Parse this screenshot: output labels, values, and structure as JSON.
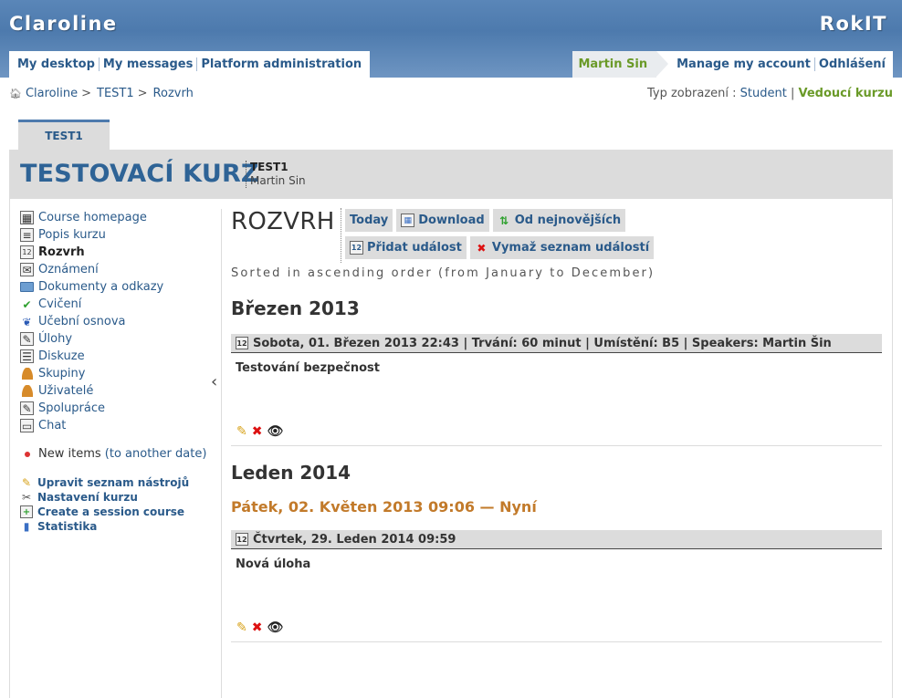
{
  "header": {
    "brand_left": "Claroline",
    "brand_right": "RokIT",
    "nav_left": [
      "My desktop",
      "My messages",
      "Platform administration"
    ],
    "user_name": "Martin Sin",
    "nav_right": [
      "Manage my account",
      "Odhlášení"
    ]
  },
  "breadcrumb": {
    "items": [
      "Claroline",
      "TEST1",
      "Rozvrh"
    ],
    "separator": ">"
  },
  "view_mode": {
    "label": "Typ zobrazení :",
    "student": "Student",
    "separator": "|",
    "manager": "Vedoucí kurzu"
  },
  "course": {
    "tab": "TEST1",
    "title": "TESTOVACÍ KURZ",
    "code": "TEST1",
    "teacher": "Martin Sin"
  },
  "sidebar": {
    "items": [
      {
        "label": "Course homepage",
        "icon": "course-homepage-icon"
      },
      {
        "label": "Popis kurzu",
        "icon": "description-icon"
      },
      {
        "label": "Rozvrh",
        "icon": "calendar-icon"
      },
      {
        "label": "Oznámení",
        "icon": "announcement-icon"
      },
      {
        "label": "Dokumenty a odkazy",
        "icon": "folder-icon"
      },
      {
        "label": "Cvičení",
        "icon": "checkmark-icon"
      },
      {
        "label": "Učební osnova",
        "icon": "learning-path-icon"
      },
      {
        "label": "Úlohy",
        "icon": "assignment-icon"
      },
      {
        "label": "Diskuze",
        "icon": "forum-icon"
      },
      {
        "label": "Skupiny",
        "icon": "groups-icon"
      },
      {
        "label": "Uživatelé",
        "icon": "users-icon"
      },
      {
        "label": "Spolupráce",
        "icon": "wiki-icon"
      },
      {
        "label": "Chat",
        "icon": "chat-icon"
      }
    ],
    "new_items_label": "New items",
    "new_items_link": "(to another date)",
    "admin": [
      {
        "label": "Upravit seznam nástrojů",
        "icon": "pencil-icon"
      },
      {
        "label": "Nastavení kurzu",
        "icon": "tools-icon"
      },
      {
        "label": "Create a session course",
        "icon": "create-session-icon"
      },
      {
        "label": "Statistika",
        "icon": "statistics-icon"
      }
    ]
  },
  "main": {
    "title": "ROZVRH",
    "toolbar": [
      {
        "label": "Today",
        "icon": ""
      },
      {
        "label": "Download",
        "icon": "download-icon"
      },
      {
        "label": "Od nejnovějších",
        "icon": "sort-arrows-icon"
      },
      {
        "label": "Přidat událost",
        "icon": "add-event-icon"
      },
      {
        "label": "Vymaž seznam událostí",
        "icon": "delete-icon"
      }
    ],
    "sorted_text": "Sorted in ascending order (from January to December)",
    "month1": "Březen 2013",
    "event1": {
      "header": "Sobota, 01. Březen 2013 22:43 | Trvání: 60 minut | Umístění: B5 | Speakers: Martin Šin",
      "title": "Testování bezpečnost"
    },
    "month2": "Leden 2014",
    "now_line": "Pátek, 02. Květen 2013 09:06 — Nyní",
    "event2": {
      "header": "Čtvrtek, 29. Leden 2014 09:59",
      "title": "Nová úloha"
    },
    "action_icons": {
      "edit": "✎",
      "delete": "✖",
      "visibility": "👁"
    }
  }
}
